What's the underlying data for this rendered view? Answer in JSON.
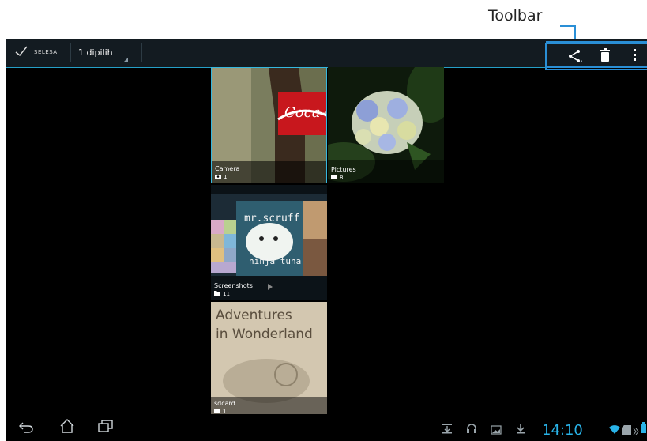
{
  "annotation": {
    "label": "Toolbar"
  },
  "action_bar": {
    "done_label": "SELESAI",
    "selection_label": "1 dipilih"
  },
  "albums": [
    {
      "name": "Camera",
      "count": "1",
      "type_icon": "camera-icon"
    },
    {
      "name": "Pictures",
      "count": "8",
      "type_icon": "folder-icon"
    },
    {
      "name": "Screenshots",
      "count": "11",
      "type_icon": "folder-icon"
    },
    {
      "name": "sdcard",
      "count": "1",
      "type_icon": "folder-icon"
    }
  ],
  "thumbnails": {
    "camera_text": "Coca-Cola",
    "screenshot_text_top": "mr.scruff",
    "screenshot_text_bottom": "ninja tuna",
    "sdcard_text": "Adventures in Wonderland"
  },
  "system_bar": {
    "time": "14:10"
  },
  "colors": {
    "accent": "#29b3e8",
    "highlight": "#2a8fd6",
    "bar_bg": "#131b21"
  }
}
